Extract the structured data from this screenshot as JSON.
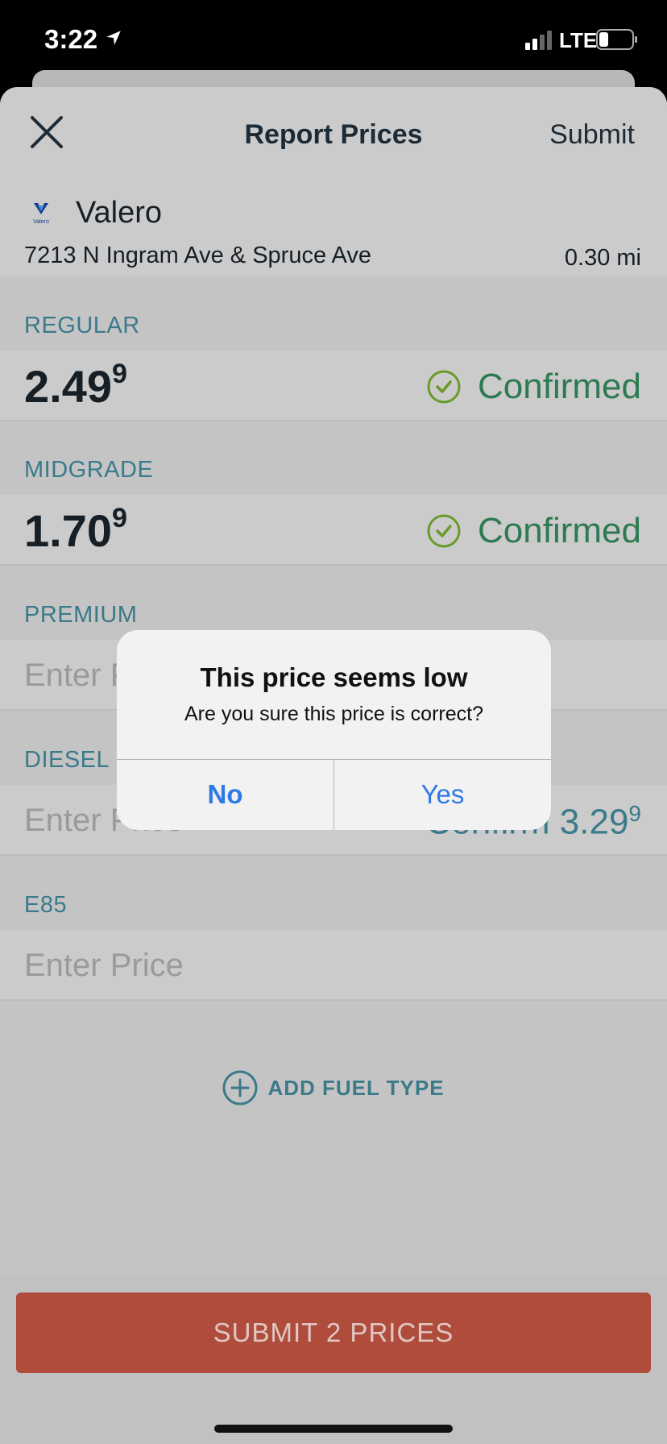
{
  "status_bar": {
    "time": "3:22",
    "network": "LTE"
  },
  "header": {
    "title": "Report Prices",
    "submit_label": "Submit",
    "close_icon": "close-icon"
  },
  "station": {
    "logo_text": "Valero",
    "name": "Valero",
    "address": "7213 N Ingram Ave & Spruce Ave",
    "distance": "0.30 mi"
  },
  "fuels": [
    {
      "label": "REGULAR",
      "price_main": "2.49",
      "price_tenth": "9",
      "status": "Confirmed"
    },
    {
      "label": "MIDGRADE",
      "price_main": "1.70",
      "price_tenth": "9",
      "status": "Confirmed"
    },
    {
      "label": "PREMIUM",
      "placeholder": "Enter Price"
    },
    {
      "label": "DIESEL",
      "placeholder": "Enter Price",
      "confirm_label": "Confirm 3.29",
      "confirm_tenth": "9"
    },
    {
      "label": "E85",
      "placeholder": "Enter Price"
    }
  ],
  "add_fuel_label": "ADD FUEL TYPE",
  "submit_button_label": "SUBMIT 2 PRICES",
  "dialog": {
    "title": "This price seems low",
    "message": "Are you sure this price is correct?",
    "no_label": "No",
    "yes_label": "Yes"
  },
  "colors": {
    "accent_teal": "#3a7a8a",
    "confirmed_green": "#2e7a52",
    "submit_red": "#b04c3c",
    "dialog_blue": "#2f7ae5"
  }
}
